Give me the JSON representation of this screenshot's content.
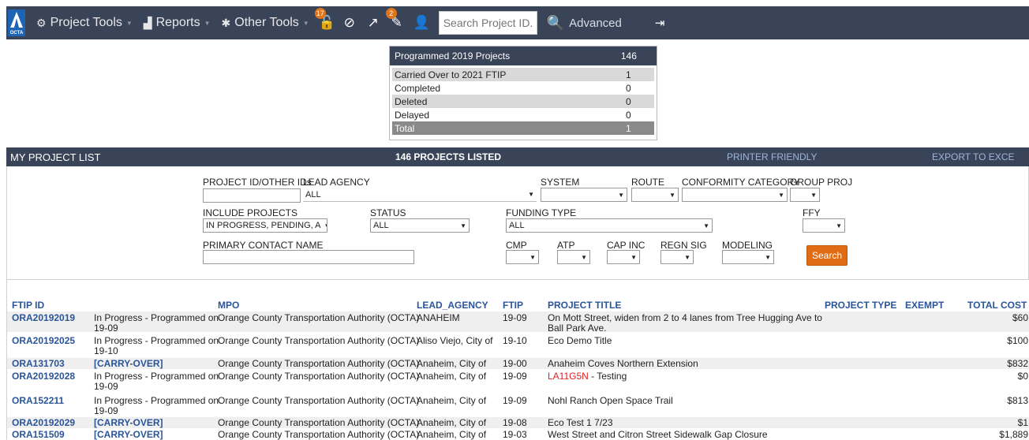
{
  "nav": {
    "logo_text": "OCTA",
    "menus": [
      {
        "label": "Project Tools",
        "icon": "gears-icon"
      },
      {
        "label": "Reports",
        "icon": "area-chart-icon"
      },
      {
        "label": "Other Tools",
        "icon": "gear-icon"
      }
    ],
    "badges": {
      "unlock": "17",
      "edit": "2"
    },
    "search_placeholder": "Search Project ID...",
    "advanced_label": "Advanced"
  },
  "summary": {
    "header_label": "Programmed 2019 Projects",
    "header_value": "146",
    "rows": [
      {
        "label": "Carried Over to 2021 FTIP",
        "value": "1"
      },
      {
        "label": "Completed",
        "value": "0"
      },
      {
        "label": "Deleted",
        "value": "0"
      },
      {
        "label": "Delayed",
        "value": "0"
      },
      {
        "label": "Total",
        "value": "1"
      }
    ]
  },
  "list": {
    "title": "MY PROJECT LIST",
    "count_label": "146 PROJECTS LISTED",
    "printer_label": "PRINTER FRIENDLY",
    "export_label": "EXPORT TO EXCE"
  },
  "filters": {
    "project_id_label": "PROJECT ID/OTHER IDs",
    "lead_agency_label": "LEAD AGENCY",
    "lead_agency_value": "ALL",
    "system_label": "SYSTEM",
    "route_label": "ROUTE",
    "conformity_label": "CONFORMITY CATEGORY",
    "group_proj_label": "GROUP PROJ",
    "include_label": "INCLUDE PROJECTS",
    "include_value": "IN PROGRESS, PENDING, A",
    "status_label": "STATUS",
    "status_value": "ALL",
    "funding_label": "FUNDING TYPE",
    "funding_value": "ALL",
    "ffy_label": "FFY",
    "contact_label": "PRIMARY CONTACT NAME",
    "cmp_label": "CMP",
    "atp_label": "ATP",
    "capinc_label": "CAP INC",
    "regnsig_label": "REGN SIG",
    "modeling_label": "MODELING",
    "search_button": "Search"
  },
  "table": {
    "headers": {
      "ftip_id": "FTIP ID",
      "mpo": "MPO",
      "lead_agency": "LEAD_AGENCY",
      "ftip": "FTIP",
      "project_title": "PROJECT TITLE",
      "project_type": "PROJECT TYPE",
      "exempt": "EXEMPT",
      "total_cost": "TOTAL COST"
    },
    "rows": [
      {
        "id": "ORA20192019",
        "status1": "In Progress - Programmed on",
        "status2": "19-09",
        "mpo": "Orange County Transportation Authority (OCTA)",
        "agency": "ANAHEIM",
        "ftip": "19-09",
        "title_prefix": "",
        "title": "On Mott Street, widen from 2 to 4 lanes from Tree Hugging Ave to",
        "title2": "Ball Park Ave.",
        "cost": "$60"
      },
      {
        "id": "ORA20192025",
        "status1": "In Progress - Programmed on",
        "status2": "19-10",
        "mpo": "Orange County Transportation Authority (OCTA)",
        "agency": "Aliso Viejo, City of",
        "ftip": "19-10",
        "title_prefix": "",
        "title": "Eco Demo Title",
        "title2": "",
        "cost": "$100"
      },
      {
        "id": "ORA131703",
        "status1": "[CARRY-OVER]",
        "status2": "",
        "mpo": "Orange County Transportation Authority (OCTA)",
        "agency": "Anaheim, City of",
        "ftip": "19-00",
        "title_prefix": "",
        "title": "Anaheim Coves Northern Extension",
        "title2": "",
        "cost": "$832"
      },
      {
        "id": "ORA20192028",
        "status1": "In Progress - Programmed on",
        "status2": "19-09",
        "mpo": "Orange County Transportation Authority (OCTA)",
        "agency": "Anaheim, City of",
        "ftip": "19-09",
        "title_prefix": "LA11G5N",
        "title": " - Testing",
        "title2": "",
        "cost": "$0"
      },
      {
        "id": "ORA152211",
        "status1": "In Progress - Programmed on",
        "status2": "19-09",
        "mpo": "Orange County Transportation Authority (OCTA)",
        "agency": "Anaheim, City of",
        "ftip": "19-09",
        "title_prefix": "",
        "title": "Nohl Ranch Open Space Trail",
        "title2": "",
        "cost": "$813"
      },
      {
        "id": "ORA20192029",
        "status1": "[CARRY-OVER]",
        "status2": "",
        "mpo": "Orange County Transportation Authority (OCTA)",
        "agency": "Anaheim, City of",
        "ftip": "19-08",
        "title_prefix": "",
        "title": "Eco Test 1 7/23",
        "title2": "",
        "cost": "$1"
      },
      {
        "id": "ORA151509",
        "status1": "[CARRY-OVER]",
        "status2": "",
        "mpo": "Orange County Transportation Authority (OCTA)",
        "agency": "Anaheim, City of",
        "ftip": "19-03",
        "title_prefix": "",
        "title": "West Street and Citron Street Sidewalk Gap Closure",
        "title2": "",
        "cost": "$1,889"
      }
    ]
  }
}
